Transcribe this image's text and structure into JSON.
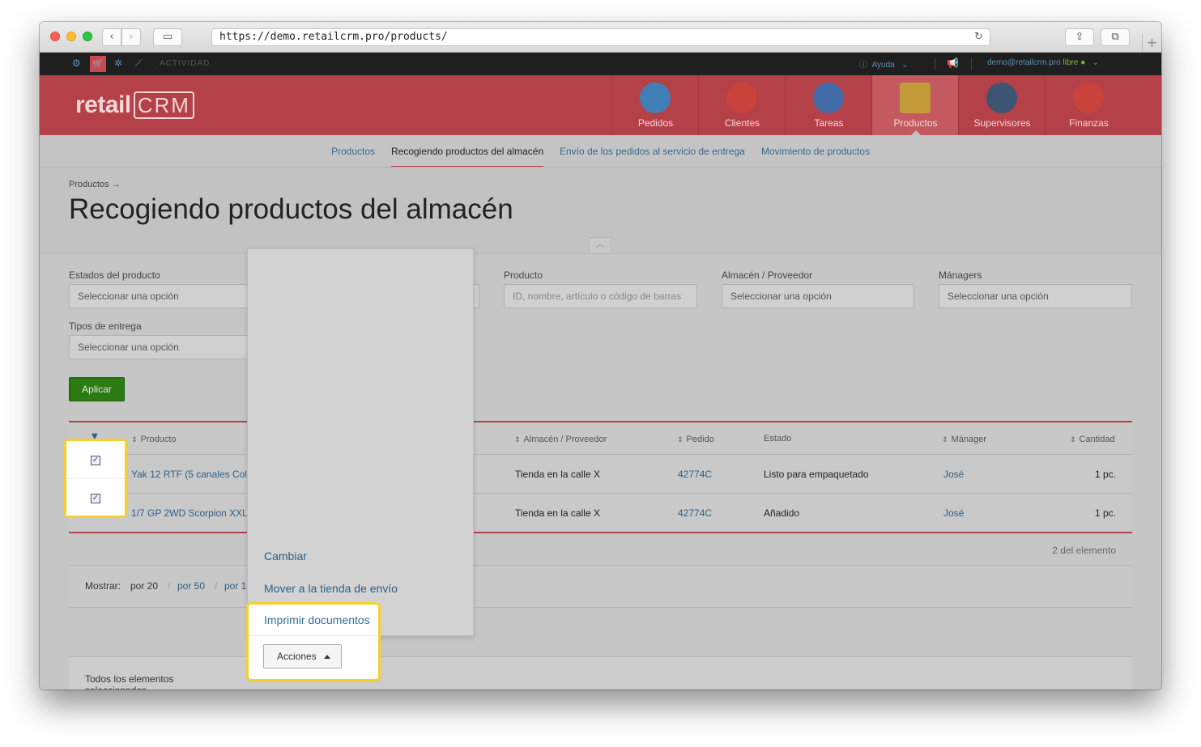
{
  "browser": {
    "url": "https://demo.retailcrm.pro/products/"
  },
  "topbar": {
    "activity_label": "ACTIVIDAD",
    "help_label": "Ayuda",
    "user_email": "demo@retailcrm.pro",
    "user_status": "libre"
  },
  "header": {
    "logo_text": "retail",
    "logo_crm": "CRM",
    "modules": [
      {
        "label": "Pedidos",
        "icon": "cart-icon",
        "color": "#3f7fb5"
      },
      {
        "label": "Clientes",
        "icon": "customer-icon",
        "color": "#c9423b"
      },
      {
        "label": "Tareas",
        "icon": "tasks-icon",
        "color": "#3f6aa5"
      },
      {
        "label": "Productos",
        "icon": "box-icon",
        "color": "#c39a3a"
      },
      {
        "label": "Supervisores",
        "icon": "supervisor-icon",
        "color": "#3b5572"
      },
      {
        "label": "Finanzas",
        "icon": "finance-icon",
        "color": "#c9423b"
      }
    ]
  },
  "subnav": {
    "items": [
      "Productos",
      "Recogiendo productos del almacén",
      "Envío de los pedidos al servicio de entrega",
      "Movimiento de productos"
    ]
  },
  "page": {
    "breadcrumb": "Productos →",
    "title": "Recogiendo productos del almacén"
  },
  "filters": {
    "estados_label": "Estados del producto",
    "estados_placeholder": "Seleccionar una opción",
    "producto_label": "Producto",
    "producto_placeholder": "ID, nombre, artículo o código de barras",
    "almacen_label": "Almacén / Proveedor",
    "almacen_placeholder": "Seleccionar una opción",
    "managers_label": "Mánagers",
    "managers_placeholder": "Seleccionar una opción",
    "tipos_label": "Tipos de entrega",
    "tipos_placeholder": "Seleccionar una opción",
    "apply_label": "Aplicar"
  },
  "table": {
    "headers": {
      "producto": "Producto",
      "almacen": "Almacén / Proveedor",
      "pedido": "Pedido",
      "estado": "Estado",
      "manager": "Mánager",
      "cantidad": "Cantidad"
    },
    "rows": [
      {
        "producto": "Yak 12 RTF (5 canales Col",
        "almacen": "Tienda en la calle X",
        "pedido": "42774C",
        "estado": "Listo para empaquetado",
        "manager": "José",
        "cantidad": "1 pc."
      },
      {
        "producto": "1/7 GP 2WD Scorpion XXL",
        "almacen": "Tienda en la calle X",
        "pedido": "42774C",
        "estado": "Añadido",
        "manager": "José",
        "cantidad": "1 pc."
      }
    ],
    "count_text": "2 del elemento"
  },
  "pager": {
    "label": "Mostrar:",
    "current": "por 20",
    "opt50": "por 50",
    "opt100": "por 1"
  },
  "bulk": {
    "selected_text": "Todos los elementos seleccionados",
    "actions_label": "Acciones",
    "menu": [
      "Cambiar",
      "Mover a la tienda de envío",
      "Imprimir documentos"
    ]
  },
  "colors": {
    "brand_red": "#b54148",
    "apply_green": "#2b7a12",
    "highlight": "#f6cf2e",
    "link": "#2f5f82"
  }
}
